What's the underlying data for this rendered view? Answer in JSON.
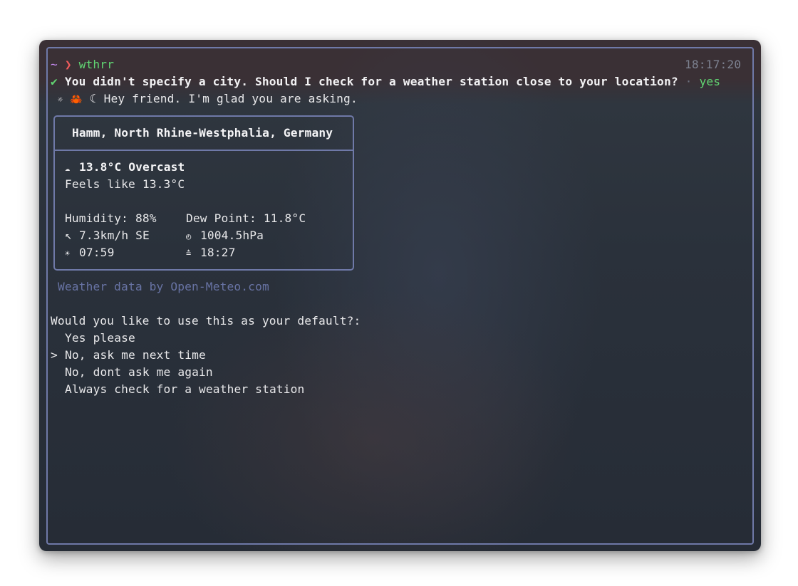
{
  "prompt": {
    "tilde": "~",
    "arrow": "❯",
    "command": "wthrr",
    "time": "18:17:20"
  },
  "question_line": {
    "check": "✔",
    "text": "You didn't specify a city. Should I check for a weather station close to your location?",
    "separator": "·",
    "answer": "yes"
  },
  "greeting": {
    "icons": [
      "☼",
      "🦀",
      "☾"
    ],
    "text": "Hey friend. I'm glad you are asking."
  },
  "weather": {
    "location": "Hamm, North Rhine-Westphalia, Germany",
    "condition_icon": "cloud-icon",
    "summary": "13.8°C Overcast",
    "feels_like": "Feels like 13.3°C",
    "humidity": "Humidity: 88%",
    "dew_point": "Dew Point: 11.8°C",
    "wind": "7.3km/h SE",
    "wind_icon": "↖",
    "pressure": "1004.5hPa",
    "sunrise": "07:59",
    "sunset": "18:27"
  },
  "attribution": "Weather data by Open-Meteo.com",
  "default_prompt": {
    "question": "Would you like to use this as your default?:",
    "selected_marker": ">",
    "options": [
      "Yes please",
      "No, ask me next time",
      "No, dont ask me again",
      "Always check for a weather station"
    ],
    "selected_index": 1
  }
}
